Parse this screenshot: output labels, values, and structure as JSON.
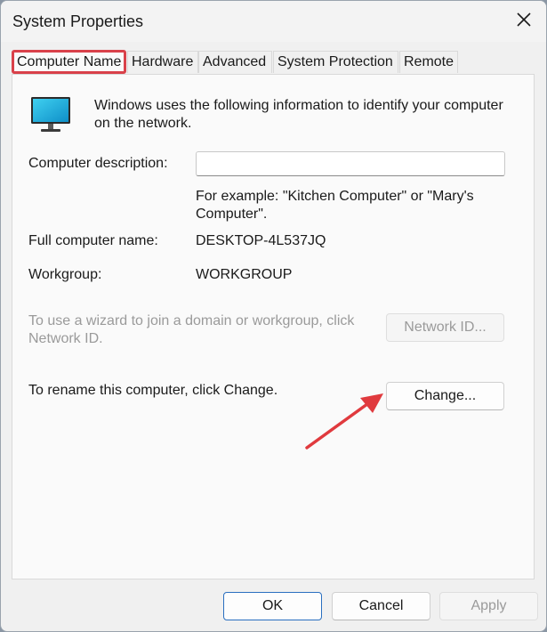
{
  "window": {
    "title": "System Properties",
    "accent_highlight": "#d9414a",
    "annotation_arrow_color": "#e03a3e"
  },
  "tabs": [
    {
      "label": "Computer Name",
      "active": true
    },
    {
      "label": "Hardware",
      "active": false
    },
    {
      "label": "Advanced",
      "active": false
    },
    {
      "label": "System Protection",
      "active": false
    },
    {
      "label": "Remote",
      "active": false
    }
  ],
  "computer_name": {
    "icon": "monitor-icon",
    "intro": "Windows uses the following information to identify your computer on the network.",
    "description_label": "Computer description:",
    "description_value": "",
    "example_text": "For example: \"Kitchen Computer\" or \"Mary's Computer\".",
    "full_name_label": "Full computer name:",
    "full_name_value": "DESKTOP-4L537JQ",
    "workgroup_label": "Workgroup:",
    "workgroup_value": "WORKGROUP",
    "wizard_text": "To use a wizard to join a domain or workgroup, click Network ID.",
    "network_id_label": "Network ID...",
    "rename_text": "To rename this computer, click Change.",
    "change_label": "Change..."
  },
  "footer": {
    "ok_label": "OK",
    "cancel_label": "Cancel",
    "apply_label": "Apply"
  }
}
